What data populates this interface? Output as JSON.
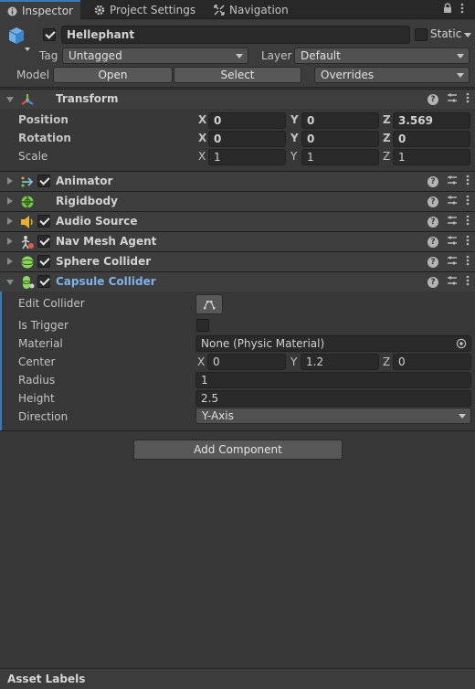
{
  "tabs": [
    {
      "label": "Inspector",
      "icon": "info-icon"
    },
    {
      "label": "Project Settings",
      "icon": "gear-icon"
    },
    {
      "label": "Navigation",
      "icon": "navigation-icon"
    }
  ],
  "object": {
    "name": "Hellephant",
    "active": true,
    "static_label": "Static",
    "tag_label": "Tag",
    "tag_value": "Untagged",
    "layer_label": "Layer",
    "layer_value": "Default",
    "model_label": "Model",
    "open_label": "Open",
    "select_label": "Select",
    "overrides_label": "Overrides"
  },
  "transform": {
    "title": "Transform",
    "rows": [
      {
        "label": "Position",
        "x": "0",
        "y": "0",
        "z": "3.569"
      },
      {
        "label": "Rotation",
        "x": "0",
        "y": "0",
        "z": "0"
      },
      {
        "label": "Scale",
        "x": "1",
        "y": "1",
        "z": "1"
      }
    ],
    "axis_x": "X",
    "axis_y": "Y",
    "axis_z": "Z"
  },
  "components": [
    {
      "title": "Animator",
      "icon": "animator-icon",
      "enabled": true
    },
    {
      "title": "Rigidbody",
      "icon": "rigidbody-icon",
      "enabled": null
    },
    {
      "title": "Audio Source",
      "icon": "audio-source-icon",
      "enabled": true
    },
    {
      "title": "Nav Mesh Agent",
      "icon": "nav-mesh-agent-icon",
      "enabled": true
    },
    {
      "title": "Sphere Collider",
      "icon": "sphere-collider-icon",
      "enabled": true
    },
    {
      "title": "Capsule Collider",
      "icon": "capsule-collider-icon",
      "enabled": true
    }
  ],
  "capsule": {
    "edit_collider_label": "Edit Collider",
    "is_trigger_label": "Is Trigger",
    "is_trigger": false,
    "material_label": "Material",
    "material_value": "None (Physic Material)",
    "center_label": "Center",
    "center": {
      "x": "0",
      "y": "1.2",
      "z": "0"
    },
    "radius_label": "Radius",
    "radius": "1",
    "height_label": "Height",
    "height": "2.5",
    "direction_label": "Direction",
    "direction": "Y-Axis"
  },
  "add_component_label": "Add Component",
  "footer_label": "Asset Labels",
  "colors": {
    "accent": "#3a79bb",
    "selected_title": "#7fb1ea",
    "background": "#383838"
  }
}
